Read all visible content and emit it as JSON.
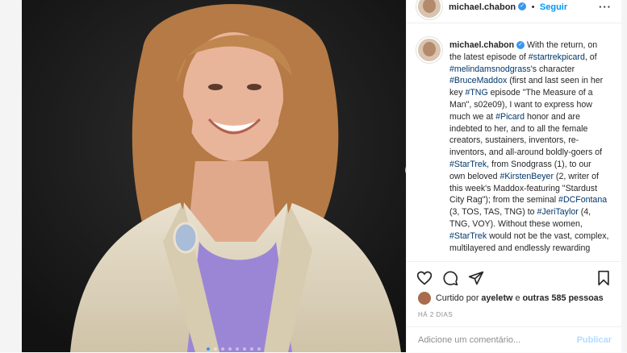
{
  "header": {
    "username": "michael.chabon",
    "separator": "•",
    "follow_label": "Seguir",
    "more_label": "···"
  },
  "caption": {
    "username": "michael.chabon",
    "parts": [
      {
        "t": "With the return, on the latest episode of "
      },
      {
        "t": "#startrekpicard",
        "tag": true
      },
      {
        "t": ", of "
      },
      {
        "t": "#melindamsnodgrass",
        "tag": true
      },
      {
        "t": "'s character "
      },
      {
        "t": "#BruceMaddox",
        "tag": true
      },
      {
        "t": " (first and last seen in her key "
      },
      {
        "t": "#TNG",
        "tag": true
      },
      {
        "t": " episode \"The Measure of a Man\", s02e09), I want to express how much we at "
      },
      {
        "t": "#Picard",
        "tag": true
      },
      {
        "t": " honor and are indebted to her, and to all the female creators, sustainers, inventors, re-inventors, and all-around boldly-goers of "
      },
      {
        "t": "#StarTrek",
        "tag": true
      },
      {
        "t": ", from Snodgrass (1), to our own beloved "
      },
      {
        "t": "#KirstenBeyer",
        "tag": true
      },
      {
        "t": " (2, writer of this week's Maddox-featuring \"Stardust City Rag\"); from the seminal "
      },
      {
        "t": "#DCFontana",
        "tag": true
      },
      {
        "t": " (3, TOS, TAS, TNG) to "
      },
      {
        "t": "#JeriTaylor",
        "tag": true
      },
      {
        "t": " (4, TNG, VOY). Without these women, "
      },
      {
        "t": "#StarTrek",
        "tag": true
      },
      {
        "t": " would not be the vast, complex, multilayered and endlessly rewarding"
      }
    ]
  },
  "icons": {
    "like": "heart-icon",
    "comment": "comment-icon",
    "share": "send-icon",
    "save": "bookmark-icon",
    "next": "chevron-right-icon",
    "verified": "verified-badge-icon"
  },
  "likes": {
    "prefix": "Curtido por",
    "user": "ayeletw",
    "middle": "e",
    "others": "outras 585 pessoas"
  },
  "time_ago": "HÁ 2 DIAS",
  "comment": {
    "placeholder": "Adicione um comentário...",
    "publish_label": "Publicar"
  },
  "carousel": {
    "slide_count": 8,
    "active_index": 0
  },
  "colors": {
    "accent": "#0095f6",
    "hashtag": "#00376b",
    "publish_disabled": "#b3dbff"
  }
}
